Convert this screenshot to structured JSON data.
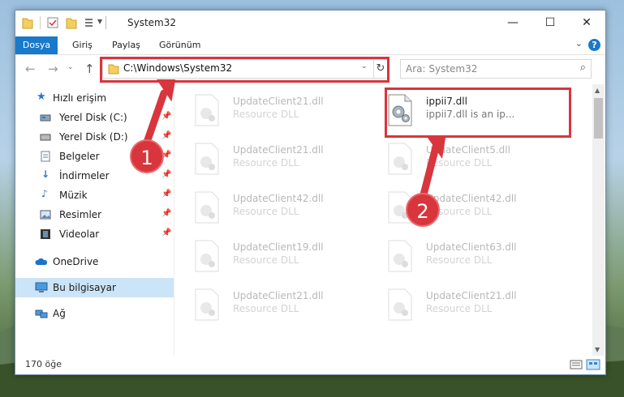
{
  "window": {
    "title": "System32",
    "controls": {
      "minimize": "—",
      "maximize": "☐",
      "close": "✕"
    }
  },
  "ribbon": {
    "tabs": [
      "Dosya",
      "Giriş",
      "Paylaş",
      "Görünüm"
    ],
    "help_label": "?"
  },
  "nav": {
    "address": "C:\\Windows\\System32",
    "search_placeholder": "Ara: System32"
  },
  "sidebar": {
    "items": [
      {
        "label": "Hızlı erişim",
        "icon": "star-icon"
      },
      {
        "label": "Yerel Disk (C:)",
        "icon": "drive-icon",
        "pinned": true
      },
      {
        "label": "Yerel Disk (D:)",
        "icon": "drive-icon",
        "pinned": true
      },
      {
        "label": "Belgeler",
        "icon": "documents-icon",
        "pinned": true
      },
      {
        "label": "İndirmeler",
        "icon": "downloads-icon",
        "pinned": true
      },
      {
        "label": "Müzik",
        "icon": "music-icon",
        "pinned": true
      },
      {
        "label": "Resimler",
        "icon": "pictures-icon",
        "pinned": true
      },
      {
        "label": "Videolar",
        "icon": "videos-icon",
        "pinned": true
      },
      {
        "label": "OneDrive",
        "icon": "onedrive-icon"
      },
      {
        "label": "Bu bilgisayar",
        "icon": "computer-icon",
        "selected": true
      },
      {
        "label": "Ağ",
        "icon": "network-icon"
      }
    ]
  },
  "files": {
    "left": [
      {
        "name": "UpdateClient21.dll",
        "type": "Resource DLL"
      },
      {
        "name": "UpdateClient21.dll",
        "type": "Resource DLL"
      },
      {
        "name": "UpdateClient42.dll",
        "type": "Resource DLL"
      },
      {
        "name": "UpdateClient19.dll",
        "type": "Resource DLL"
      },
      {
        "name": "UpdateClient21.dll",
        "type": "Resource DLL"
      }
    ],
    "right": [
      {
        "name": "ippii7.dll",
        "type": "ippii7.dll is an ip..."
      },
      {
        "name": "UpdateClient5.dll",
        "type": "Resource DLL"
      },
      {
        "name": "UpdateClient42.dll",
        "type": "Resource DLL"
      },
      {
        "name": "UpdateClient63.dll",
        "type": "Resource DLL"
      },
      {
        "name": "UpdateClient21.dll",
        "type": "Resource DLL"
      }
    ]
  },
  "status": {
    "item_count": "170 öğe"
  },
  "annotations": {
    "step1": "1",
    "step2": "2",
    "accent": "#d9353d"
  }
}
